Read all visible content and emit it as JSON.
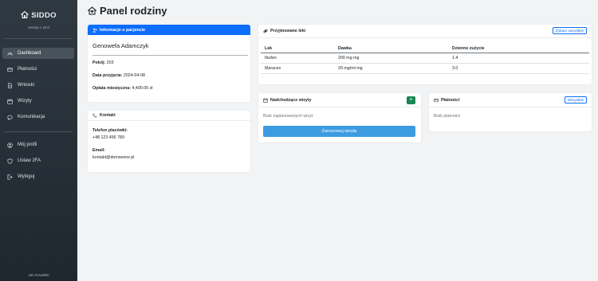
{
  "app": {
    "brand": "SIDDO",
    "version": "wersja 1.16.0",
    "user": "Jan Kowalski"
  },
  "sidebar": {
    "main": [
      {
        "label": "Dashboard",
        "icon": "gauge-icon",
        "active": true
      },
      {
        "label": "Płatności",
        "icon": "credit-card-icon"
      },
      {
        "label": "Wnioski",
        "icon": "file-icon"
      },
      {
        "label": "Wizyty",
        "icon": "calendar-icon"
      },
      {
        "label": "Komunikacja",
        "icon": "chat-icon"
      }
    ],
    "account": [
      {
        "label": "Mój profil",
        "icon": "user-circle-icon"
      },
      {
        "label": "Ustaw 2FA",
        "icon": "shield-icon"
      },
      {
        "label": "Wyloguj",
        "icon": "logout-icon"
      }
    ]
  },
  "page": {
    "title": "Panel rodziny"
  },
  "patient": {
    "header": "Informacje o pacjencie",
    "name": "Genowefa Adamczyk",
    "room_label": "Pokój:",
    "room": "203",
    "admission_label": "Data przyjęcia:",
    "admission": "2024-04-08",
    "fee_label": "Opłata miesięczna:",
    "fee": "4,400.00 zł"
  },
  "contact": {
    "header": "Kontakt",
    "phone_label": "Telefon placówki:",
    "phone": "+48 123 456 789",
    "email_label": "Email:",
    "email": "kontakt@domsenior.pl"
  },
  "meds": {
    "header": "Przyjmowane leki",
    "see_all": "Zobacz wszystkie",
    "columns": [
      "Lek",
      "Dawka",
      "Dzienne zużycie"
    ],
    "rows": [
      [
        "Ibufen",
        "200 mg mg",
        "1.4"
      ],
      [
        "Maracex",
        "20 mg/ml mg",
        "3.0"
      ]
    ]
  },
  "visits": {
    "header": "Nadchodzące wizyty",
    "add": "+",
    "empty": "Brak zaplanowanych wizyt",
    "book": "Zarezerwuj wizytę"
  },
  "payments": {
    "header": "Płatności",
    "all": "Wszystkie",
    "empty": "Brak płatności"
  },
  "colors": {
    "primary": "#0d6efd",
    "success": "#198754",
    "sidebar": "#2a333b"
  }
}
